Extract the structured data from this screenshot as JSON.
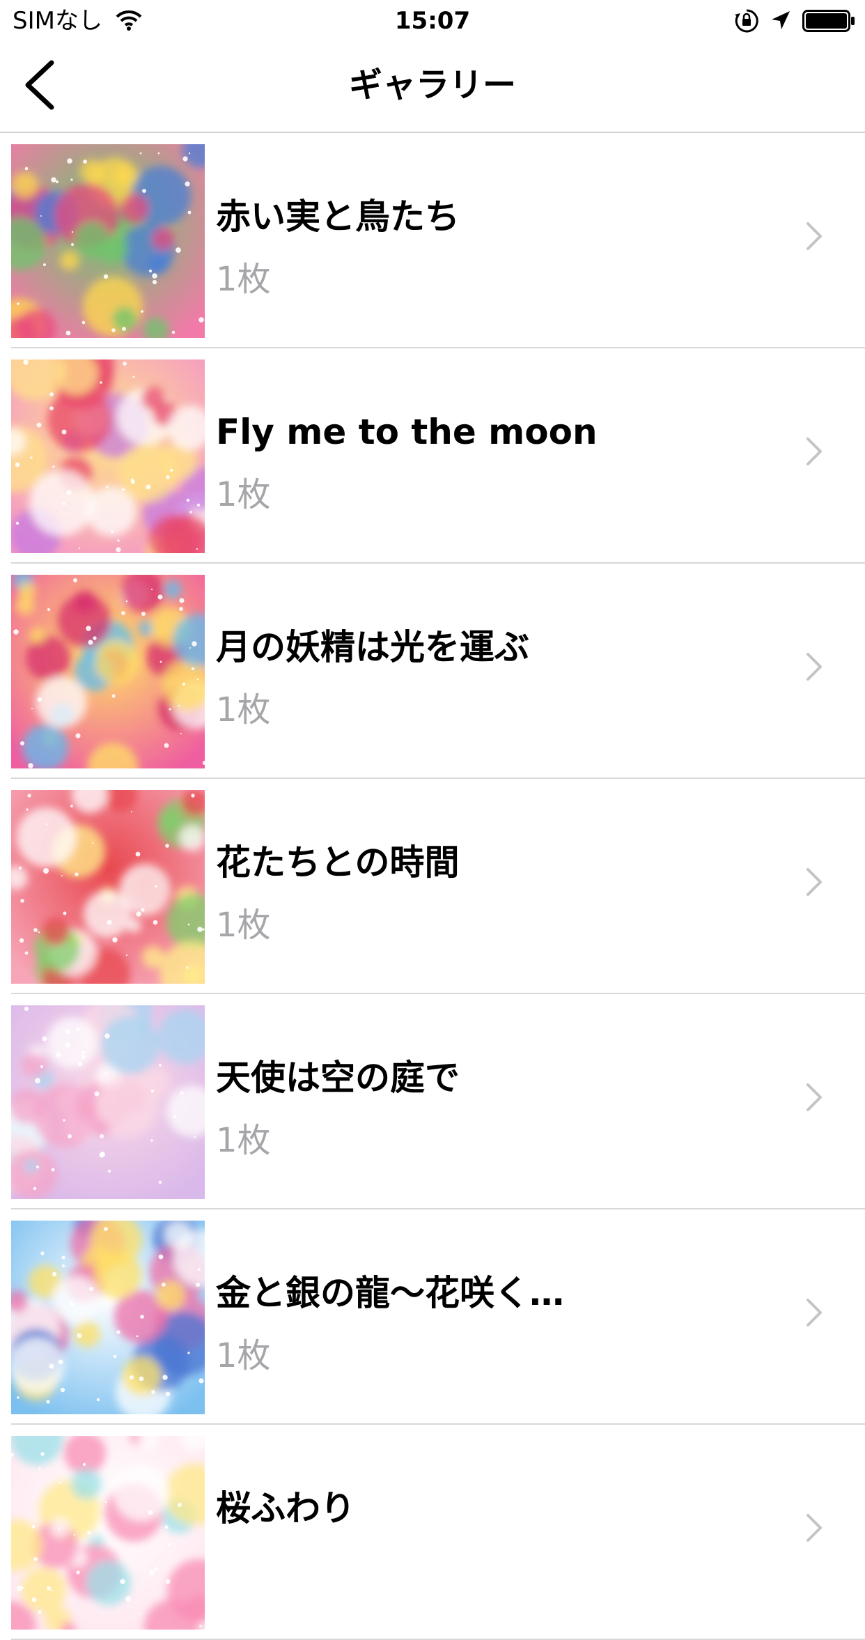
{
  "status_bar": {
    "carrier": "SIMなし",
    "time": "15:07",
    "wifi_icon": "wifi-icon",
    "rotation_lock_icon": "lock-rotation-icon",
    "location_icon": "location-arrow-icon",
    "battery_icon": "battery-icon"
  },
  "nav": {
    "title": "ギャラリー",
    "back_icon": "chevron-left-icon"
  },
  "gallery": {
    "items": [
      {
        "title": "赤い実と鳥たち",
        "count": "1枚",
        "palette": [
          "#f27aa8",
          "#e8487c",
          "#6cc56b",
          "#ffd84d",
          "#4b7fd6"
        ]
      },
      {
        "title": "Fly me to the moon",
        "count": "1枚",
        "palette": [
          "#f598c6",
          "#ffffff",
          "#ffe28a",
          "#e8486a",
          "#c77ae0"
        ]
      },
      {
        "title": "月の妖精は光を運ぶ",
        "count": "1枚",
        "palette": [
          "#ef5ea0",
          "#ffffff",
          "#ffe066",
          "#d72f6c",
          "#5fbcef"
        ]
      },
      {
        "title": "花たちとの時間",
        "count": "1枚",
        "palette": [
          "#f7a6b8",
          "#ffef8a",
          "#e8484f",
          "#7fcf6b",
          "#ffffff"
        ]
      },
      {
        "title": "天使は空の庭で",
        "count": "1枚",
        "palette": [
          "#d9b8ea",
          "#ffffff",
          "#fbd9e6",
          "#a7d6f2",
          "#f4a4c8"
        ]
      },
      {
        "title": "金と銀の龍〜花咲く…",
        "count": "1枚",
        "palette": [
          "#7cc0f0",
          "#ffe066",
          "#ffffff",
          "#ee6fa8",
          "#4a74d2"
        ]
      },
      {
        "title": "桜ふわり",
        "count": "",
        "palette": [
          "#ffe6ef",
          "#f88cb4",
          "#ffffff",
          "#ffe88a",
          "#9be0e8"
        ]
      }
    ],
    "chevron_icon": "chevron-right-icon"
  }
}
